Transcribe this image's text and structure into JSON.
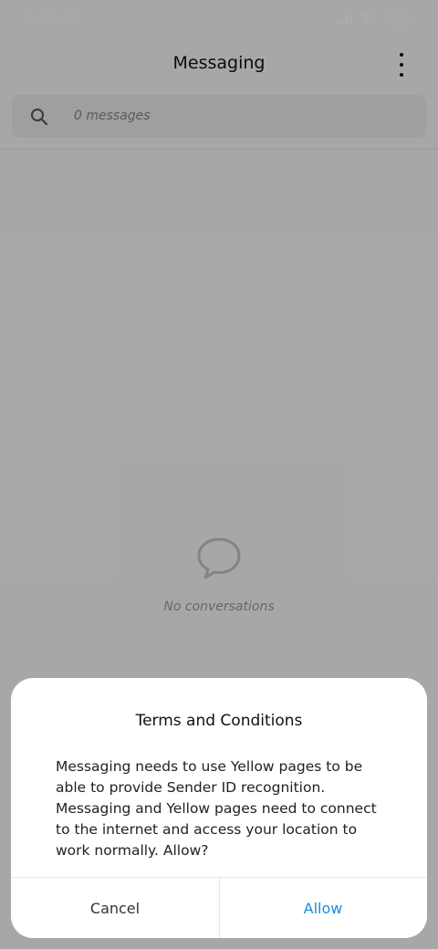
{
  "status_bar": {
    "time": "2:36 AM",
    "battery": "100",
    "icons": [
      "signal-icon",
      "wifi-icon",
      "battery-icon"
    ]
  },
  "app_bar": {
    "title": "Messaging",
    "menu_icon": "more-vertical-icon"
  },
  "search": {
    "placeholder": "0 messages",
    "icon": "search-icon"
  },
  "empty_state": {
    "icon": "chat-bubble-icon",
    "text": "No conversations"
  },
  "dialog": {
    "title": "Terms and Conditions",
    "body": "Messaging needs to use Yellow pages to be able to provide Sender ID recognition. Messaging and Yellow pages need to connect to the internet and access your location to work normally. Allow?",
    "cancel_label": "Cancel",
    "allow_label": "Allow"
  },
  "colors": {
    "accent": "#1a8fdc",
    "scrim": "#000000"
  }
}
